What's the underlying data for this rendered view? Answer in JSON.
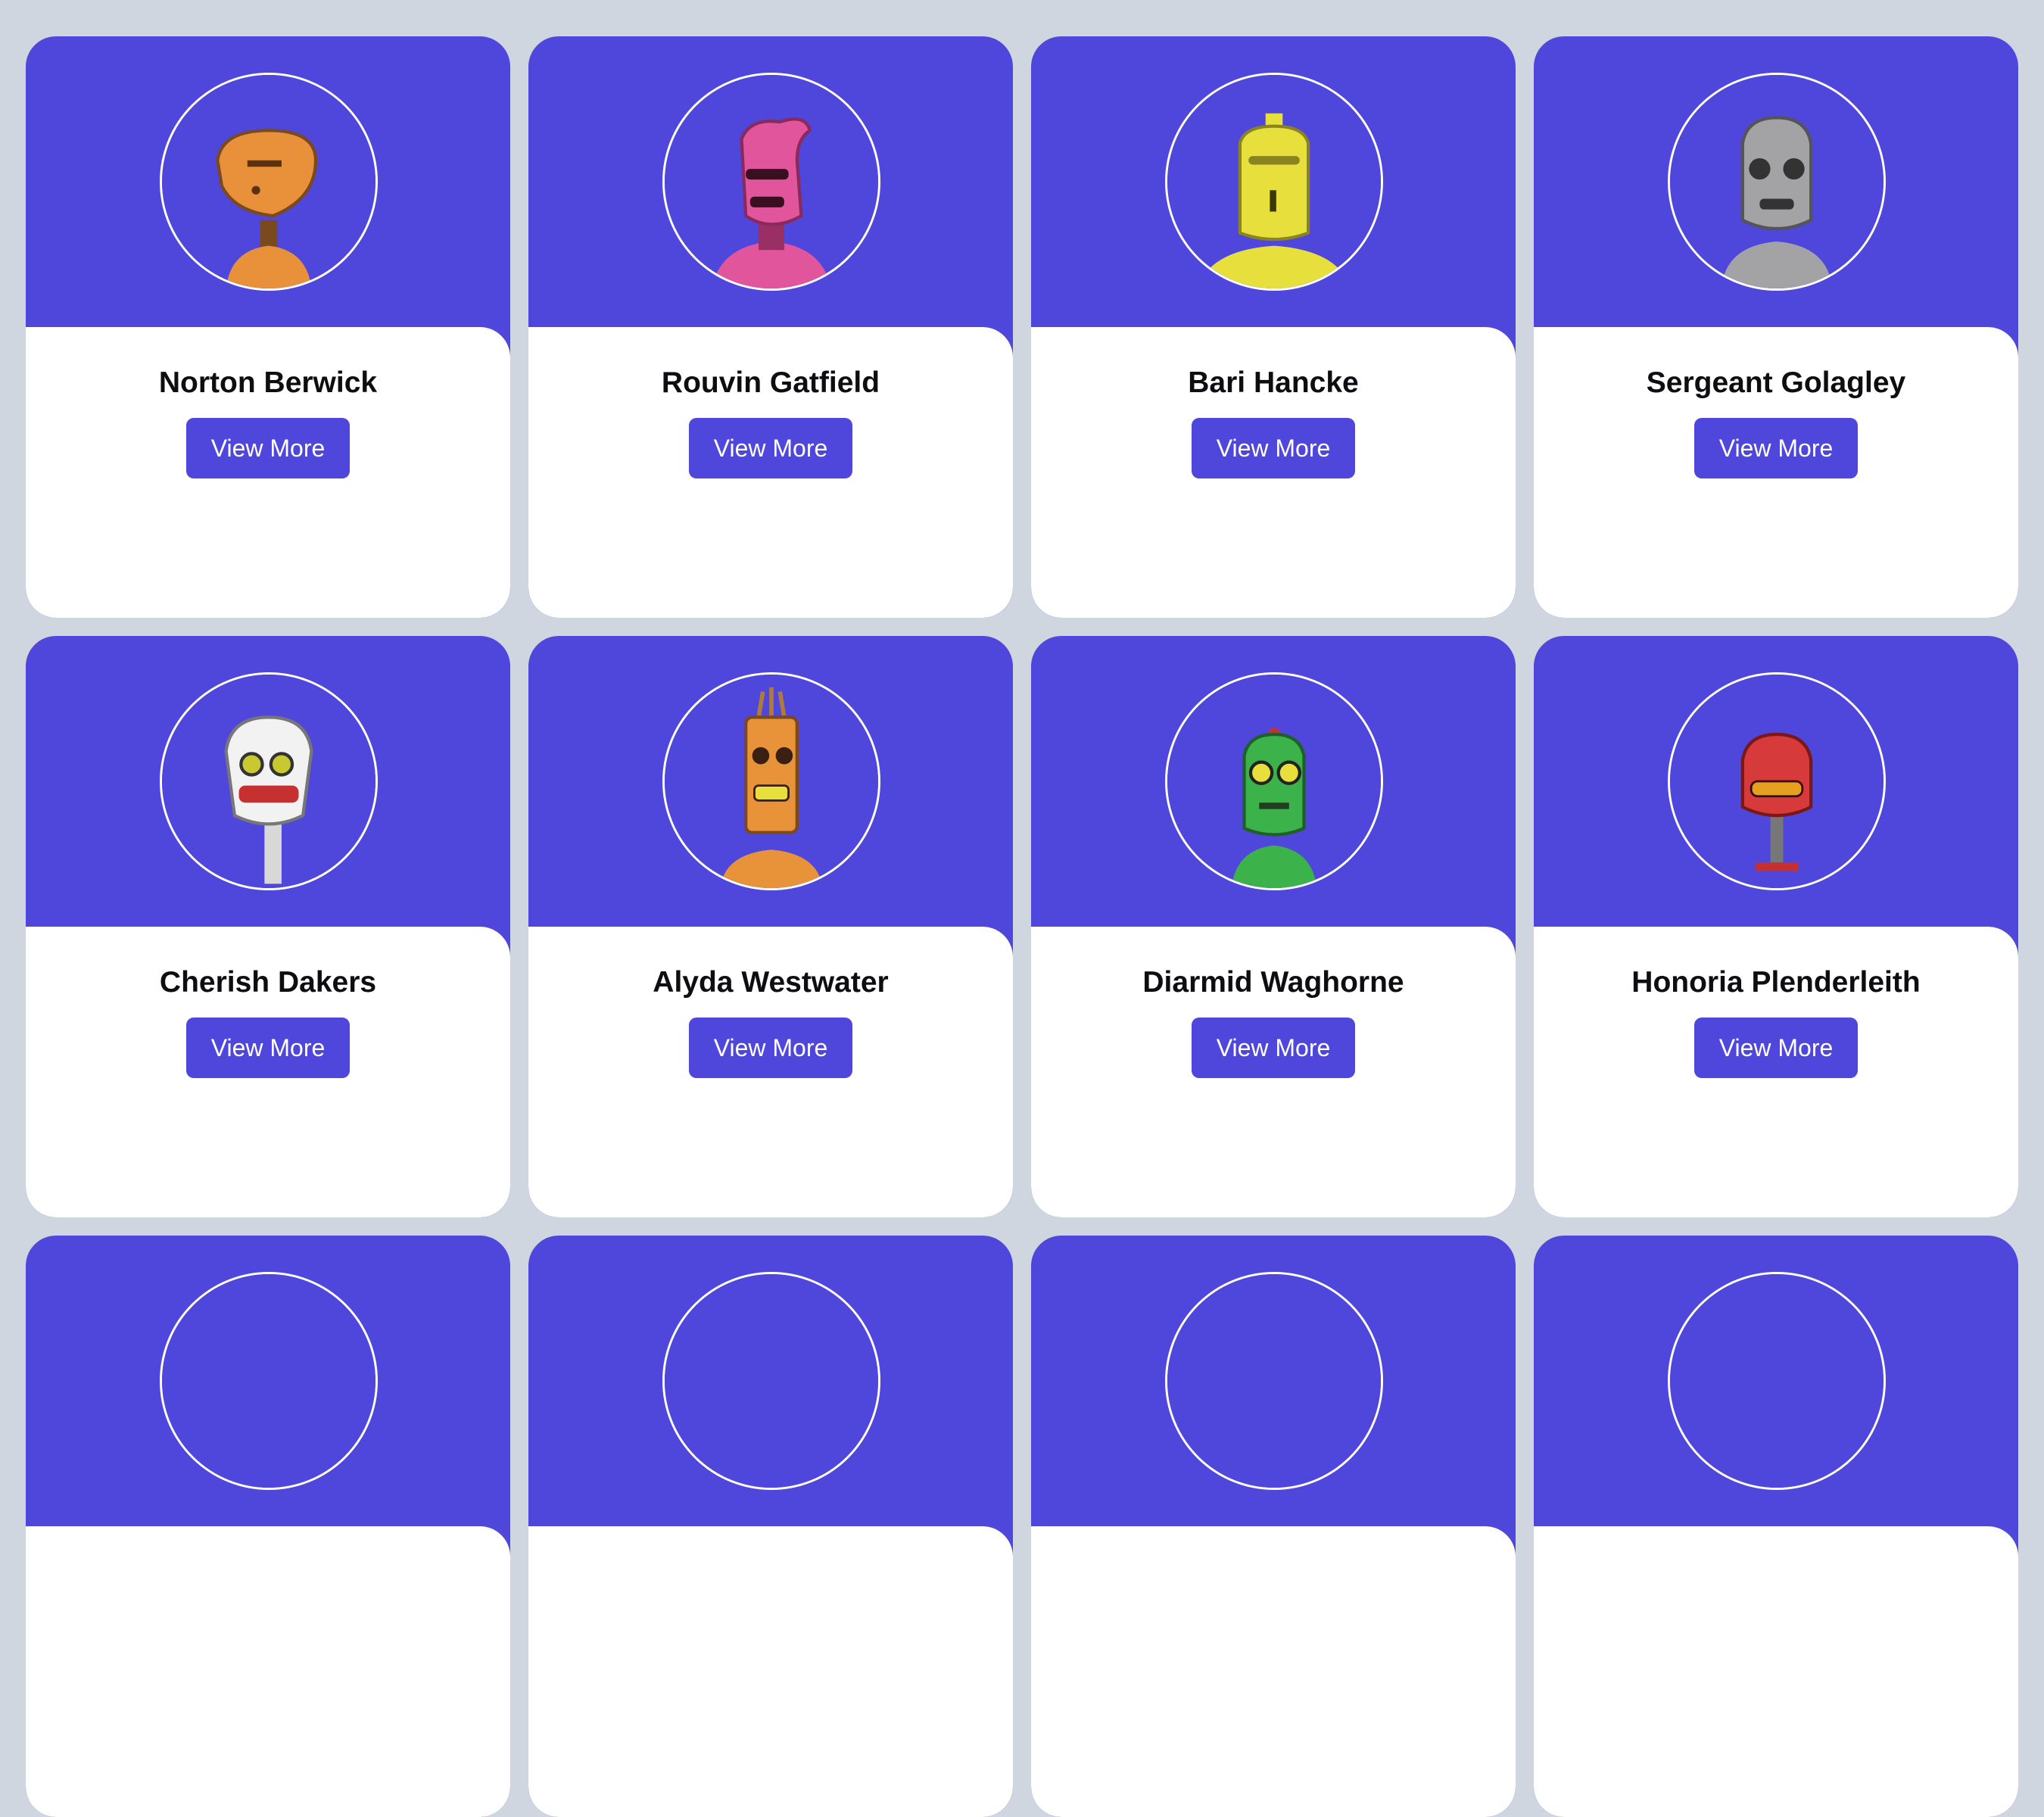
{
  "cards": [
    {
      "name": "Norton Berwick",
      "button_label": "View More",
      "avatar_icon": "orange-robot-avatar",
      "color": "#e8913a"
    },
    {
      "name": "Rouvin Gatfield",
      "button_label": "View More",
      "avatar_icon": "pink-robot-avatar",
      "color": "#e0559c"
    },
    {
      "name": "Bari Hancke",
      "button_label": "View More",
      "avatar_icon": "yellow-robot-avatar",
      "color": "#e6df3c"
    },
    {
      "name": "Sergeant Golagley",
      "button_label": "View More",
      "avatar_icon": "gray-robot-avatar",
      "color": "#a3a3a6"
    },
    {
      "name": "Cherish Dakers",
      "button_label": "View More",
      "avatar_icon": "white-robot-avatar",
      "color": "#f2f2f2"
    },
    {
      "name": "Alyda Westwater",
      "button_label": "View More",
      "avatar_icon": "orange-robot-avatar",
      "color": "#e8923a"
    },
    {
      "name": "Diarmid Waghorne",
      "button_label": "View More",
      "avatar_icon": "green-robot-avatar",
      "color": "#3bb24a"
    },
    {
      "name": "Honoria Plenderleith",
      "button_label": "View More",
      "avatar_icon": "red-robot-avatar",
      "color": "#d73a3a"
    },
    {
      "name": "",
      "button_label": "",
      "avatar_icon": "robot-avatar",
      "color": "#cccccc"
    },
    {
      "name": "",
      "button_label": "",
      "avatar_icon": "robot-avatar",
      "color": "#cccccc"
    },
    {
      "name": "",
      "button_label": "",
      "avatar_icon": "robot-avatar",
      "color": "#cccccc"
    },
    {
      "name": "",
      "button_label": "",
      "avatar_icon": "robot-avatar",
      "color": "#cccccc"
    }
  ],
  "theme": {
    "accent": "#4f46dc",
    "page_background": "#cfd6e0",
    "card_body": "#ffffff"
  }
}
